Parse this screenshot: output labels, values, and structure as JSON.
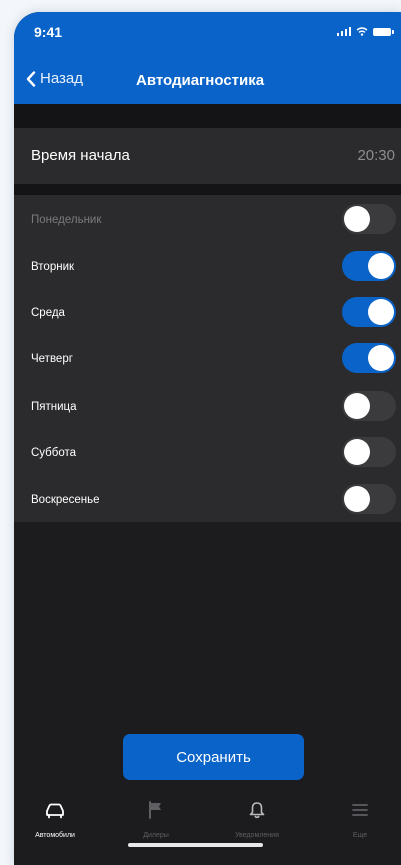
{
  "status": {
    "time": "9:41",
    "icons": [
      "signal-icon",
      "wifi-icon",
      "battery-icon"
    ]
  },
  "nav": {
    "back_icon": "chevron-left-icon",
    "back_label": "Назад",
    "title": "Автодиагностика"
  },
  "start_time": {
    "label": "Время начала",
    "value": "20:30"
  },
  "days": [
    {
      "label": "Понедельник",
      "enabled": false,
      "dimmed": true
    },
    {
      "label": "Вторник",
      "enabled": true,
      "dimmed": false
    },
    {
      "label": "Среда",
      "enabled": true,
      "dimmed": false
    },
    {
      "label": "Четверг",
      "enabled": true,
      "dimmed": false
    },
    {
      "label": "Пятница",
      "enabled": false,
      "dimmed": false
    },
    {
      "label": "Суббота",
      "enabled": false,
      "dimmed": false
    },
    {
      "label": "Воскресенье",
      "enabled": false,
      "dimmed": false
    }
  ],
  "save_button": {
    "label": "Сохранить"
  },
  "tabs": [
    {
      "label": "Автомобили",
      "icon": "car-icon",
      "active": true
    },
    {
      "label": "Дилеры",
      "icon": "flag-icon",
      "active": false
    },
    {
      "label": "Уведомления",
      "icon": "bell-icon",
      "active": false
    },
    {
      "label": "Еще",
      "icon": "menu-icon",
      "active": false
    }
  ],
  "colors": {
    "accent": "#0a63c9",
    "background": "#1c1c1e",
    "cell": "#2b2b2d",
    "toggle_off": "#3b3b3e",
    "secondary_text": "#8d8d91"
  }
}
